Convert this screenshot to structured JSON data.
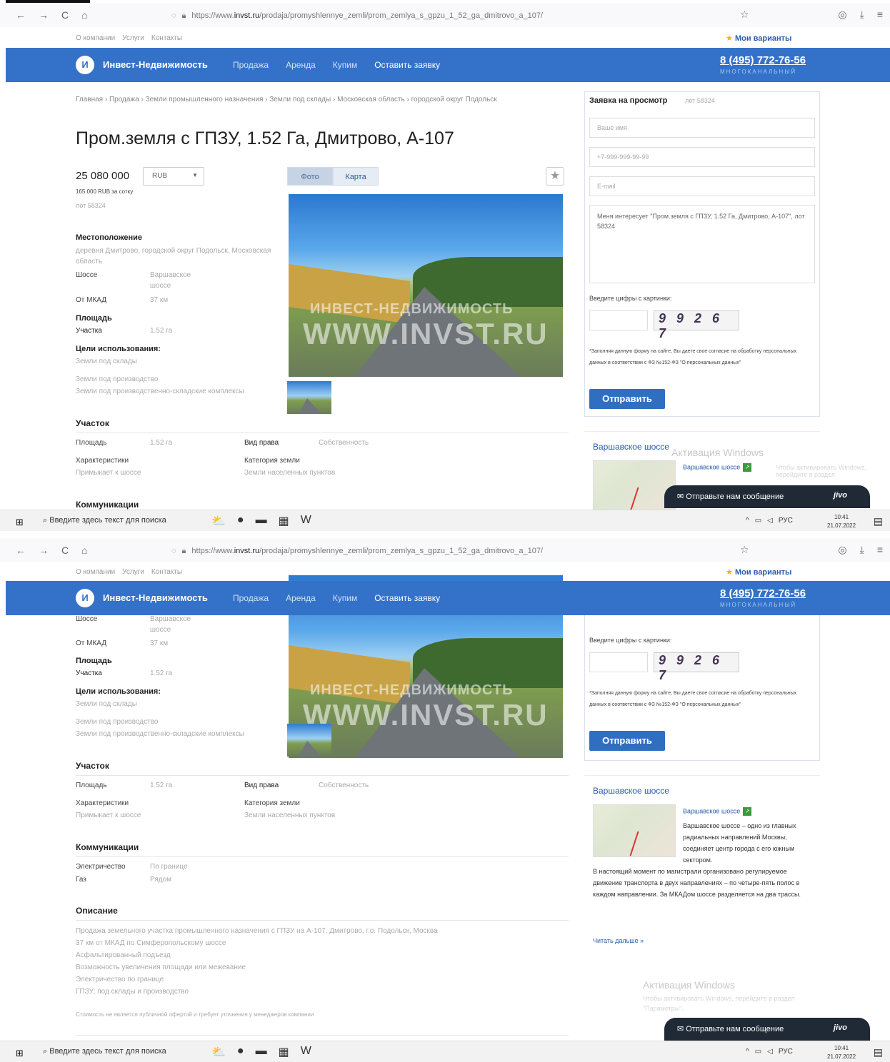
{
  "browser": {
    "url_prefix": "https://www.",
    "url_domain": "invst.ru",
    "url_path": "/prodaja/promyshlennye_zemli/prom_zemlya_s_gpzu_1_52_ga_dmitrovo_a_107/",
    "back": "←",
    "forward": "→",
    "reload": "C",
    "home": "⌂"
  },
  "toplinks": {
    "about": "О компании",
    "team": "Услуги",
    "contacts": "Контакты",
    "favorites": "Мои варианты"
  },
  "header": {
    "logo": "И",
    "brand": "Инвест-Недвижимость",
    "menu": [
      "Продажа",
      "Аренда",
      "Купим",
      "Оставить заявку"
    ],
    "phone": "8 (495) 772-76-56",
    "phone_sub": "МНОГОКАНАЛЬНЫЙ"
  },
  "listing": {
    "breadcrumb": "Главная › Продажа › Земли промышленного назначения › Земли под склады › Московская область › городской округ Подольск",
    "title": "Пром.земля с ГПЗУ, 1.52 Га, Дмитрово, А-107",
    "price": "25 080 000",
    "currency": "RUB",
    "price_per": "165 000 RUB за сотку",
    "lot": "лот 58324",
    "tab_photo": "Фото",
    "tab_map": "Карта",
    "watermark_top": "ИНВЕСТ-НЕДВИЖИМОСТЬ",
    "watermark_bottom": "WWW.INVST.RU"
  },
  "location": {
    "heading": "Местоположение",
    "address": "деревня Дмитрово, городской округ Подольск, Московская область",
    "highway_label": "Шоссе",
    "highway_value": "Варшавское шоссе",
    "mkad_label": "От МКАД",
    "mkad_value": "37 км",
    "area_heading": "Площадь",
    "plot_label": "Участка",
    "plot_value": "1.52 га",
    "use_heading": "Цели использования:",
    "uses": [
      "Земли под склады",
      "Земли под производство",
      "Земли под производственно-складские комплексы"
    ]
  },
  "plot": {
    "heading": "Участок",
    "area_label": "Площадь",
    "area_value": "1.52 га",
    "right_label": "Вид права",
    "right_value": "Собственность",
    "char_label": "Характеристики",
    "char_value": "Примыкает к шоссе",
    "cat_label": "Категория земли",
    "cat_value": "Земли населенных пунктов"
  },
  "utilities": {
    "heading": "Коммуникации",
    "elec_label": "Электричество",
    "elec_value": "По границе",
    "gas_label": "Газ",
    "gas_value": "Рядом"
  },
  "description": {
    "heading": "Описание",
    "lines": [
      "Продажа земельного участка промышленного назначения с ГПЗУ на А-107, Дмитрово, г.о. Подольск, Москва",
      "37 км от МКАД по Симферопольскому шоссе",
      "Асфальтированный подъезд",
      "Возможность увеличения площади или межевание",
      "Электричество по границе",
      "ГПЗУ: под склады и производство"
    ],
    "disclaimer": "Стоимость не является публичной офертой и требует уточнения у менеджеров компании"
  },
  "form": {
    "heading": "Заявка на просмотр",
    "lot": "лот 58324",
    "name_ph": "Ваше имя",
    "phone_ph": "+7-999-999-99-99",
    "email_ph": "E-mail",
    "message": "Меня интересует \"Пром.земля с ГПЗУ, 1.52 Га, Дмитрово, А-107\", лот 58324",
    "captcha_label": "Введите цифры с картинки:",
    "captcha_code": "9 9 2 6 7",
    "consent": "*Заполняя данную форму на сайте, Вы даете свое согласие на обработку персональных данных в соответствии с ФЗ №152-ФЗ \"О персональных данных\"",
    "submit": "Отправить"
  },
  "highway": {
    "title": "Варшавское шоссе",
    "link": "Варшавское шоссе",
    "text_a": "Варшавское шоссе – одно из главных радиальных направлений Москвы, соединяет центр города с его южным сектором.",
    "text_b": "В настоящий момент по магистрали организовано регулируемое движение транспорта в двух направлениях – по четыре-пять полос в каждом направлении. За МКАДом шоссе разделяется на два трассы.",
    "more": "Читать дальше »"
  },
  "chat": {
    "text": "Отправьте нам сообщение",
    "brand": "jivo"
  },
  "windows": {
    "activation": "Активация Windows",
    "activation_sub": "Чтобы активировать Windows, перейдите в раздел",
    "params": "\"Параметры\"."
  },
  "taskbar": {
    "search": "Введите здесь текст для поиска",
    "lang": "РУС",
    "time": "10:41",
    "date": "21.07.2022"
  }
}
